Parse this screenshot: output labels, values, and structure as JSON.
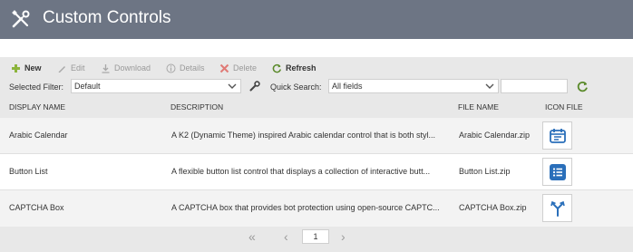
{
  "header": {
    "title": "Custom Controls",
    "icon": "wrench-screwdriver-icon",
    "bg_color": "#6d7584"
  },
  "toolbar": {
    "new_label": "New",
    "edit_label": "Edit",
    "download_label": "Download",
    "details_label": "Details",
    "delete_label": "Delete",
    "refresh_label": "Refresh"
  },
  "filter": {
    "selected_filter_label": "Selected Filter:",
    "selected_filter_value": "Default",
    "quick_search_label": "Quick Search:",
    "quick_search_field": "All fields",
    "search_text": ""
  },
  "table": {
    "columns": [
      "DISPLAY NAME",
      "DESCRIPTION",
      "FILE NAME",
      "ICON FILE"
    ],
    "rows": [
      {
        "name": "Arabic Calendar",
        "description": "A K2 (Dynamic Theme) inspired Arabic calendar control that is both styl...",
        "file": "Arabic Calendar.zip",
        "icon": "calendar-icon"
      },
      {
        "name": "Button List",
        "description": "A flexible button list control that displays a collection of interactive butt...",
        "file": "Button List.zip",
        "icon": "list-icon"
      },
      {
        "name": "CAPTCHA Box",
        "description": "A CAPTCHA box that provides bot protection using open-source CAPTC...",
        "file": "CAPTCHA Box.zip",
        "icon": "branch-icon"
      }
    ]
  },
  "pager": {
    "current_page": "1"
  },
  "colors": {
    "accent": "#2a6fba",
    "new_green": "#8cb43c",
    "delete_red": "#d9534f",
    "refresh_green": "#5a8a2a"
  }
}
